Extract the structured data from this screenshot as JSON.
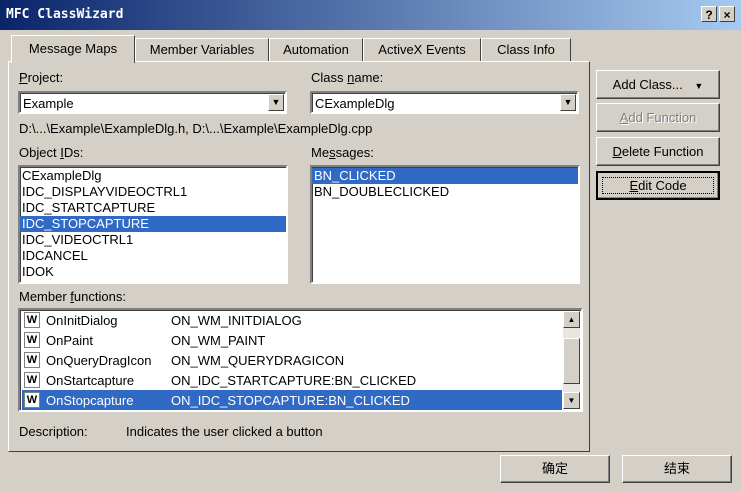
{
  "window": {
    "title": "MFC ClassWizard",
    "help_button": "?",
    "close_button": "×"
  },
  "tabs": [
    {
      "label": "Message Maps",
      "active": true
    },
    {
      "label": "Member Variables"
    },
    {
      "label": "Automation"
    },
    {
      "label": "ActiveX Events"
    },
    {
      "label": "Class Info"
    }
  ],
  "project": {
    "label_underline": "P",
    "label_rest": "roject:",
    "value": "Example"
  },
  "class_name": {
    "label_prefix": "Class ",
    "label_underline": "n",
    "label_rest": "ame:",
    "value": "CExampleDlg"
  },
  "file_path": "D:\\...\\Example\\ExampleDlg.h, D:\\...\\Example\\ExampleDlg.cpp",
  "object_ids": {
    "label_prefix": "Object ",
    "label_underline": "I",
    "label_rest": "Ds:",
    "items": [
      "CExampleDlg",
      "IDC_DISPLAYVIDEOCTRL1",
      "IDC_STARTCAPTURE",
      "IDC_STOPCAPTURE",
      "IDC_VIDEOCTRL1",
      "IDCANCEL",
      "IDOK"
    ],
    "selected_index": 3
  },
  "messages": {
    "label_prefix": "Me",
    "label_underline": "s",
    "label_rest": "sages:",
    "items": [
      "BN_CLICKED",
      "BN_DOUBLECLICKED"
    ],
    "selected_index": 0
  },
  "member_functions": {
    "label_prefix": "Member ",
    "label_underline": "f",
    "label_rest": "unctions:",
    "icon_letter": "W",
    "rows": [
      {
        "name": "OnInitDialog",
        "message": "ON_WM_INITDIALOG"
      },
      {
        "name": "OnPaint",
        "message": "ON_WM_PAINT"
      },
      {
        "name": "OnQueryDragIcon",
        "message": "ON_WM_QUERYDRAGICON"
      },
      {
        "name": "OnStartcapture",
        "message": "ON_IDC_STARTCAPTURE:BN_CLICKED"
      },
      {
        "name": "OnStopcapture",
        "message": "ON_IDC_STOPCAPTURE:BN_CLICKED"
      }
    ],
    "selected_index": 4
  },
  "description": {
    "label": "Description:",
    "text": "Indicates the user clicked a button"
  },
  "buttons": {
    "add_class": "Add Class...",
    "add_class_arrow": "▼",
    "add_function_u": "A",
    "add_function_rest": "dd Function",
    "delete_function_u": "D",
    "delete_function_rest": "elete Function",
    "edit_code_u": "E",
    "edit_code_rest": "dit Code",
    "ok": "确定",
    "cancel": "结束"
  },
  "icons": {
    "dropdown": "▼",
    "scroll_up": "▲",
    "scroll_down": "▼"
  }
}
